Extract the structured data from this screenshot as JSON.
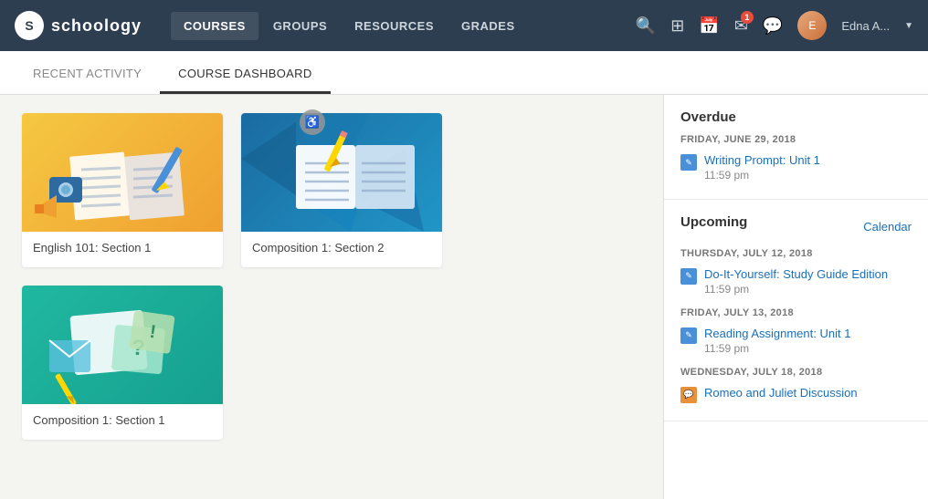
{
  "navbar": {
    "logo_text": "schoology",
    "logo_letter": "S",
    "links": [
      {
        "label": "COURSES",
        "active": true
      },
      {
        "label": "GROUPS",
        "active": false
      },
      {
        "label": "RESOURCES",
        "active": false
      },
      {
        "label": "GRADES",
        "active": false
      }
    ],
    "notification_count": "1",
    "username": "Edna A..."
  },
  "tabs": [
    {
      "label": "RECENT ACTIVITY",
      "active": false
    },
    {
      "label": "COURSE DASHBOARD",
      "active": true
    }
  ],
  "courses": [
    {
      "id": "english",
      "title": "English 101: Section 1",
      "thumb_type": "english"
    },
    {
      "id": "comp2",
      "title": "Composition 1: Section 2",
      "thumb_type": "comp2"
    },
    {
      "id": "comp1",
      "title": "Composition 1: Section 1",
      "thumb_type": "comp1"
    }
  ],
  "sidebar": {
    "overdue_title": "Overdue",
    "overdue_items": [
      {
        "date": "FRIDAY, JUNE 29, 2018",
        "title": "Writing Prompt: Unit 1",
        "time": "11:59 pm"
      }
    ],
    "upcoming_title": "Upcoming",
    "calendar_label": "Calendar",
    "upcoming_items": [
      {
        "date": "THURSDAY, JULY 12, 2018",
        "title": "Do-It-Yourself: Study Guide Edition",
        "time": "11:59 pm"
      },
      {
        "date": "FRIDAY, JULY 13, 2018",
        "title": "Reading Assignment: Unit 1",
        "time": "11:59 pm"
      },
      {
        "date": "WEDNESDAY, JULY 18, 2018",
        "title": "Romeo and Juliet Discussion",
        "time": ""
      }
    ]
  }
}
